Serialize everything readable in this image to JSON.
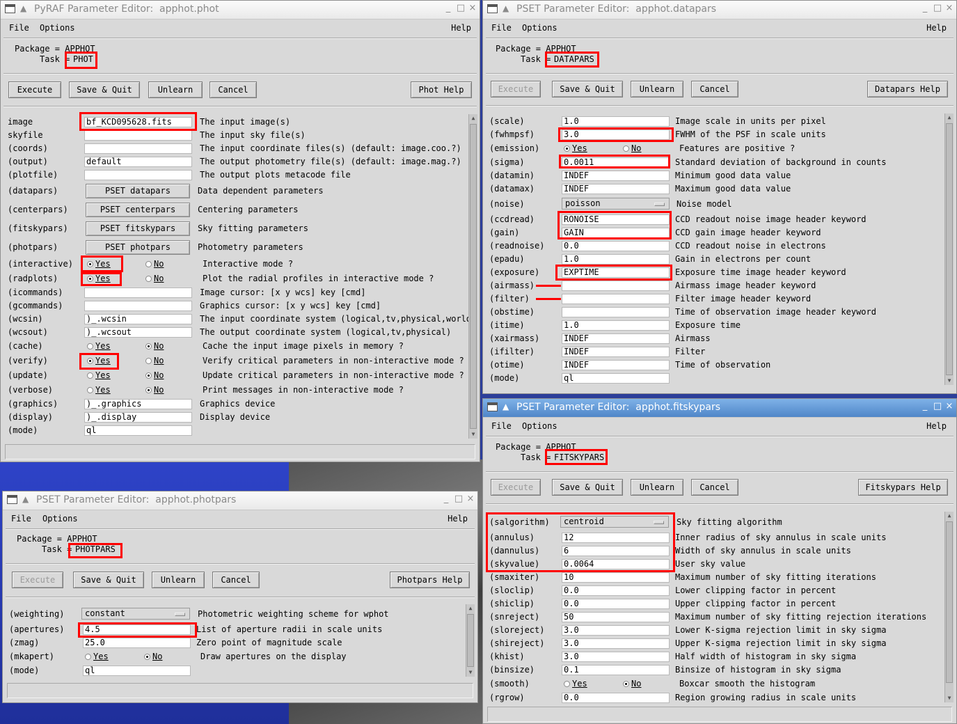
{
  "phot": {
    "title": "PyRAF Parameter Editor:  apphot.phot",
    "menu": {
      "file": "File",
      "options": "Options",
      "help": "Help"
    },
    "package_line": "Package = APPHOT",
    "task_label": "Task",
    "task_value": "PHOT",
    "buttons": {
      "execute": "Execute",
      "save_quit": "Save & Quit",
      "unlearn": "Unlearn",
      "cancel": "Cancel",
      "help": "Phot Help"
    },
    "params": {
      "image": {
        "label": "image",
        "value": "bf_KCD095628.fits",
        "desc": "The input image(s)"
      },
      "skyfile": {
        "label": "skyfile",
        "value": "",
        "desc": "The input sky file(s)"
      },
      "coords": {
        "label": "(coords)",
        "value": "",
        "desc": "The input coordinate files(s) (default: image.coo.?)"
      },
      "output": {
        "label": "(output)",
        "value": "default",
        "desc": "The output photometry file(s) (default: image.mag.?)"
      },
      "plotfile": {
        "label": "(plotfile)",
        "value": "",
        "desc": "The output plots metacode file"
      },
      "datapars": {
        "label": "(datapars)",
        "button": "PSET datapars",
        "desc": "Data dependent parameters"
      },
      "centerpars": {
        "label": "(centerpars)",
        "button": "PSET centerpars",
        "desc": "Centering parameters"
      },
      "fitskypars": {
        "label": "(fitskypars)",
        "button": "PSET fitskypars",
        "desc": "Sky fitting parameters"
      },
      "photpars": {
        "label": "(photpars)",
        "button": "PSET photpars",
        "desc": "Photometry parameters"
      },
      "interactive": {
        "label": "(interactive)",
        "desc": "Interactive mode ?"
      },
      "radplots": {
        "label": "(radplots)",
        "desc": "Plot the radial profiles in interactive mode ?"
      },
      "icommands": {
        "label": "(icommands)",
        "value": "",
        "desc": "Image cursor: [x y wcs] key [cmd]"
      },
      "gcommands": {
        "label": "(gcommands)",
        "value": "",
        "desc": "Graphics cursor: [x y wcs] key [cmd]"
      },
      "wcsin": {
        "label": "(wcsin)",
        "value": ")_.wcsin",
        "desc": "The input coordinate system (logical,tv,physical,world)"
      },
      "wcsout": {
        "label": "(wcsout)",
        "value": ")_.wcsout",
        "desc": "The output coordinate system (logical,tv,physical)"
      },
      "cache": {
        "label": "(cache)",
        "desc": "Cache the input image pixels in memory ?"
      },
      "verify": {
        "label": "(verify)",
        "desc": "Verify critical parameters in non-interactive mode ?"
      },
      "update": {
        "label": "(update)",
        "desc": "Update critical parameters in non-interactive mode ?"
      },
      "verbose": {
        "label": "(verbose)",
        "desc": "Print messages in non-interactive mode ?"
      },
      "graphics": {
        "label": "(graphics)",
        "value": ")_.graphics",
        "desc": "Graphics device"
      },
      "display": {
        "label": "(display)",
        "value": ")_.display",
        "desc": "Display device"
      },
      "mode": {
        "label": "(mode)",
        "value": "ql",
        "desc": ""
      }
    }
  },
  "yes": "Yes",
  "no": "No",
  "datapars": {
    "title": "PSET Parameter Editor:  apphot.datapars",
    "menu": {
      "file": "File",
      "options": "Options",
      "help": "Help"
    },
    "package_line": "Package = APPHOT",
    "task_label": "Task",
    "task_value": "DATAPARS",
    "buttons": {
      "execute": "Execute",
      "save_quit": "Save & Quit",
      "unlearn": "Unlearn",
      "cancel": "Cancel",
      "help": "Datapars Help"
    },
    "params": {
      "scale": {
        "label": "(scale)",
        "value": "1.0",
        "desc": "Image scale in units per pixel"
      },
      "fwhmpsf": {
        "label": "(fwhmpsf)",
        "value": "3.0",
        "desc": "FWHM of the PSF in scale units"
      },
      "emission": {
        "label": "(emission)",
        "desc": "Features are positive ?"
      },
      "sigma": {
        "label": "(sigma)",
        "value": "0.0011",
        "desc": "Standard deviation of background in counts"
      },
      "datamin": {
        "label": "(datamin)",
        "value": "INDEF",
        "desc": "Minimum good data value"
      },
      "datamax": {
        "label": "(datamax)",
        "value": "INDEF",
        "desc": "Maximum good data value"
      },
      "noise": {
        "label": "(noise)",
        "value": "poisson",
        "desc": "Noise model"
      },
      "ccdread": {
        "label": "(ccdread)",
        "value": "RONOISE",
        "desc": "CCD readout noise image header keyword"
      },
      "gain": {
        "label": "(gain)",
        "value": "GAIN",
        "desc": "CCD gain image header keyword"
      },
      "readnoise": {
        "label": "(readnoise)",
        "value": "0.0",
        "desc": "CCD readout noise in electrons"
      },
      "epadu": {
        "label": "(epadu)",
        "value": "1.0",
        "desc": "Gain in electrons per count"
      },
      "exposure": {
        "label": "(exposure)",
        "value": "EXPTIME",
        "desc": "Exposure time image header keyword"
      },
      "airmass": {
        "label": "(airmass)",
        "value": "",
        "desc": "Airmass image header keyword"
      },
      "filter": {
        "label": "(filter)",
        "value": "",
        "desc": "Filter image header keyword"
      },
      "obstime": {
        "label": "(obstime)",
        "value": "",
        "desc": "Time of observation image header keyword"
      },
      "itime": {
        "label": "(itime)",
        "value": "1.0",
        "desc": "Exposure time"
      },
      "xairmass": {
        "label": "(xairmass)",
        "value": "INDEF",
        "desc": "Airmass"
      },
      "ifilter": {
        "label": "(ifilter)",
        "value": "INDEF",
        "desc": "Filter"
      },
      "otime": {
        "label": "(otime)",
        "value": "INDEF",
        "desc": "Time of observation"
      },
      "mode": {
        "label": "(mode)",
        "value": "ql",
        "desc": ""
      }
    }
  },
  "fitskypars": {
    "title": "PSET Parameter Editor:  apphot.fitskypars",
    "menu": {
      "file": "File",
      "options": "Options",
      "help": "Help"
    },
    "package_line": "Package = APPHOT",
    "task_label": "Task",
    "task_value": "FITSKYPARS",
    "buttons": {
      "execute": "Execute",
      "save_quit": "Save & Quit",
      "unlearn": "Unlearn",
      "cancel": "Cancel",
      "help": "Fitskypars Help"
    },
    "params": {
      "salgorithm": {
        "label": "(salgorithm)",
        "value": "centroid",
        "desc": "Sky fitting algorithm"
      },
      "annulus": {
        "label": "(annulus)",
        "value": "12",
        "desc": "Inner radius of sky annulus in scale units"
      },
      "dannulus": {
        "label": "(dannulus)",
        "value": "6",
        "desc": "Width of sky annulus in scale units"
      },
      "skyvalue": {
        "label": "(skyvalue)",
        "value": "0.0064",
        "desc": "User sky value"
      },
      "smaxiter": {
        "label": "(smaxiter)",
        "value": "10",
        "desc": "Maximum number of sky fitting iterations"
      },
      "sloclip": {
        "label": "(sloclip)",
        "value": "0.0",
        "desc": "Lower clipping factor in percent"
      },
      "shiclip": {
        "label": "(shiclip)",
        "value": "0.0",
        "desc": "Upper clipping factor in percent"
      },
      "snreject": {
        "label": "(snreject)",
        "value": "50",
        "desc": "Maximum number of sky fitting rejection iterations"
      },
      "sloreject": {
        "label": "(sloreject)",
        "value": "3.0",
        "desc": "Lower K-sigma rejection limit in sky sigma"
      },
      "shireject": {
        "label": "(shireject)",
        "value": "3.0",
        "desc": "Upper K-sigma rejection limit in sky sigma"
      },
      "khist": {
        "label": "(khist)",
        "value": "3.0",
        "desc": "Half width of histogram in sky sigma"
      },
      "binsize": {
        "label": "(binsize)",
        "value": "0.1",
        "desc": "Binsize of histogram in sky sigma"
      },
      "smooth": {
        "label": "(smooth)",
        "desc": "Boxcar smooth the histogram"
      },
      "rgrow": {
        "label": "(rgrow)",
        "value": "0.0",
        "desc": "Region growing radius in scale units"
      }
    }
  },
  "photpars": {
    "title": "PSET Parameter Editor:  apphot.photpars",
    "menu": {
      "file": "File",
      "options": "Options",
      "help": "Help"
    },
    "package_line": "Package = APPHOT",
    "task_label": "Task",
    "task_value": "PHOTPARS",
    "buttons": {
      "execute": "Execute",
      "save_quit": "Save & Quit",
      "unlearn": "Unlearn",
      "cancel": "Cancel",
      "help": "Photpars Help"
    },
    "params": {
      "weighting": {
        "label": "(weighting)",
        "value": "constant",
        "desc": "Photometric weighting scheme for wphot"
      },
      "apertures": {
        "label": "(apertures)",
        "value": "4.5",
        "desc": "List of aperture radii in scale units"
      },
      "zmag": {
        "label": "(zmag)",
        "value": "25.0",
        "desc": "Zero point of magnitude scale"
      },
      "mkapert": {
        "label": "(mkapert)",
        "desc": "Draw apertures on the display"
      },
      "mode": {
        "label": "(mode)",
        "value": "ql",
        "desc": ""
      }
    }
  }
}
